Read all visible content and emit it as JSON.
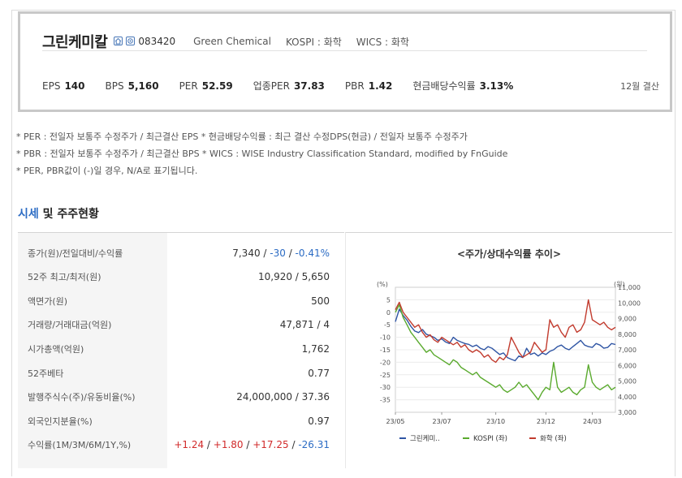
{
  "company": {
    "name": "그린케미칼",
    "code": "083420",
    "english_name": "Green Chemical",
    "market": "KOSPI : 화학",
    "wics": "WICS : 화학",
    "icons": [
      "home-icon",
      "ir-icon"
    ]
  },
  "metrics": [
    {
      "label": "EPS",
      "value": "140"
    },
    {
      "label": "BPS",
      "value": "5,160"
    },
    {
      "label": "PER",
      "value": "52.59"
    },
    {
      "label": "업종PER",
      "value": "37.83"
    },
    {
      "label": "PBR",
      "value": "1.42"
    },
    {
      "label": "현금배당수익률",
      "value": "3.13%"
    }
  ],
  "fiscal_note": "12월 결산",
  "notes": [
    "* PER : 전일자 보통주 수정주가 / 최근결산 EPS * 현금배당수익률 : 최근 결산 수정DPS(현금) / 전일자 보통주 수정주가",
    "* PBR : 전일자 보통주 수정주가 / 최근결산 BPS * WICS : WISE Industry Classification Standard, modified by FnGuide",
    "* PER, PBR값이 (-)일 경우, N/A로 표기됩니다."
  ],
  "section": {
    "title_blue": "시세",
    "title_rest": " 및 주주현황"
  },
  "stats": [
    {
      "label": "종가(원)/전일대비/수익률",
      "parts": [
        {
          "text": "7,340",
          "tone": "normal"
        },
        {
          "text": " / ",
          "tone": "normal"
        },
        {
          "text": "-30",
          "tone": "neg"
        },
        {
          "text": " / ",
          "tone": "normal"
        },
        {
          "text": "-0.41%",
          "tone": "neg"
        }
      ]
    },
    {
      "label": "52주 최고/최저(원)",
      "parts": [
        {
          "text": "10,920 / 5,650",
          "tone": "normal"
        }
      ]
    },
    {
      "label": "액면가(원)",
      "parts": [
        {
          "text": "500",
          "tone": "normal"
        }
      ]
    },
    {
      "label": "거래량/거래대금(억원)",
      "parts": [
        {
          "text": "47,871 / 4",
          "tone": "normal"
        }
      ]
    },
    {
      "label": "시가총액(억원)",
      "parts": [
        {
          "text": "1,762",
          "tone": "normal"
        }
      ]
    },
    {
      "label": "52주베타",
      "parts": [
        {
          "text": "0.77",
          "tone": "normal"
        }
      ]
    },
    {
      "label": "발행주식수(주)/유동비율(%)",
      "parts": [
        {
          "text": "24,000,000 / 37.36",
          "tone": "normal"
        }
      ]
    },
    {
      "label": "외국인지분율(%)",
      "parts": [
        {
          "text": "0.97",
          "tone": "normal"
        }
      ]
    },
    {
      "label": "수익률(1M/3M/6M/1Y,%)",
      "parts": [
        {
          "text": "+1.24",
          "tone": "pos"
        },
        {
          "text": " / ",
          "tone": "normal"
        },
        {
          "text": "+1.80",
          "tone": "pos"
        },
        {
          "text": " / ",
          "tone": "normal"
        },
        {
          "text": "+17.25",
          "tone": "pos"
        },
        {
          "text": " / ",
          "tone": "normal"
        },
        {
          "text": "-26.31",
          "tone": "neg"
        }
      ]
    }
  ],
  "chart_data": {
    "type": "line",
    "title": "<주가/상대수익률 추이>",
    "left_axis_label": "(%)",
    "right_axis_label": "(원)",
    "x_ticks": [
      "23/05",
      "23/07",
      "23/10",
      "23/12",
      "24/03"
    ],
    "y_left_ticks": [
      5,
      0,
      -5,
      -10,
      -15,
      -20,
      -25,
      -30,
      -35
    ],
    "y_left_lim": [
      -40,
      10
    ],
    "y_right_ticks": [
      "11,000",
      "10,000",
      "9,000",
      "8,000",
      "7,000",
      "6,000",
      "5,000",
      "4,000",
      "3,000"
    ],
    "y_right_lim": [
      3000,
      11000
    ],
    "series": [
      {
        "name": "그린케미..",
        "axis": "right",
        "color": "#2f55a4",
        "values": [
          8800,
          9600,
          9200,
          8900,
          8500,
          8200,
          8100,
          8300,
          8000,
          7900,
          7800,
          7600,
          7700,
          7500,
          7400,
          7800,
          7600,
          7500,
          7400,
          7350,
          7200,
          7300,
          7100,
          7000,
          7200,
          7100,
          6900,
          6700,
          6800,
          6500,
          6400,
          6300,
          6600,
          6500,
          7100,
          6700,
          6800,
          6600,
          6800,
          6700,
          6900,
          7000,
          7200,
          7300,
          7100,
          7000,
          7200,
          7400,
          7600,
          7300,
          7200,
          7150,
          7400,
          7300,
          7100,
          7150,
          7400,
          7340
        ]
      },
      {
        "name": "KOSPI (좌)",
        "axis": "left",
        "color": "#5aaa2e",
        "values": [
          0,
          3,
          -2,
          -5,
          -8,
          -10,
          -12,
          -14,
          -16,
          -15,
          -17,
          -18,
          -19,
          -20,
          -21,
          -19,
          -20,
          -22,
          -23,
          -24,
          -25,
          -24,
          -26,
          -27,
          -28,
          -29,
          -30,
          -29,
          -31,
          -32,
          -31,
          -30,
          -28,
          -30,
          -29,
          -31,
          -33,
          -35,
          -32,
          -30,
          -31,
          -20,
          -30,
          -32,
          -31,
          -30,
          -32,
          -33,
          -31,
          -30,
          -21,
          -28,
          -30,
          -31,
          -30,
          -29,
          -31,
          -30
        ]
      },
      {
        "name": "화학 (좌)",
        "axis": "left",
        "color": "#c23b2e",
        "values": [
          1,
          4,
          0,
          -2,
          -4,
          -6,
          -5,
          -8,
          -10,
          -9,
          -11,
          -12,
          -10,
          -11,
          -12,
          -13,
          -12,
          -14,
          -13,
          -15,
          -16,
          -15,
          -16,
          -18,
          -17,
          -19,
          -20,
          -18,
          -19,
          -17,
          -10,
          -13,
          -16,
          -18,
          -17,
          -16,
          -12,
          -14,
          -16,
          -15,
          -3,
          -6,
          -5,
          -8,
          -10,
          -6,
          -5,
          -8,
          -7,
          -4,
          5,
          -3,
          -4,
          -5,
          -4,
          -6,
          -7,
          -6
        ]
      }
    ]
  }
}
